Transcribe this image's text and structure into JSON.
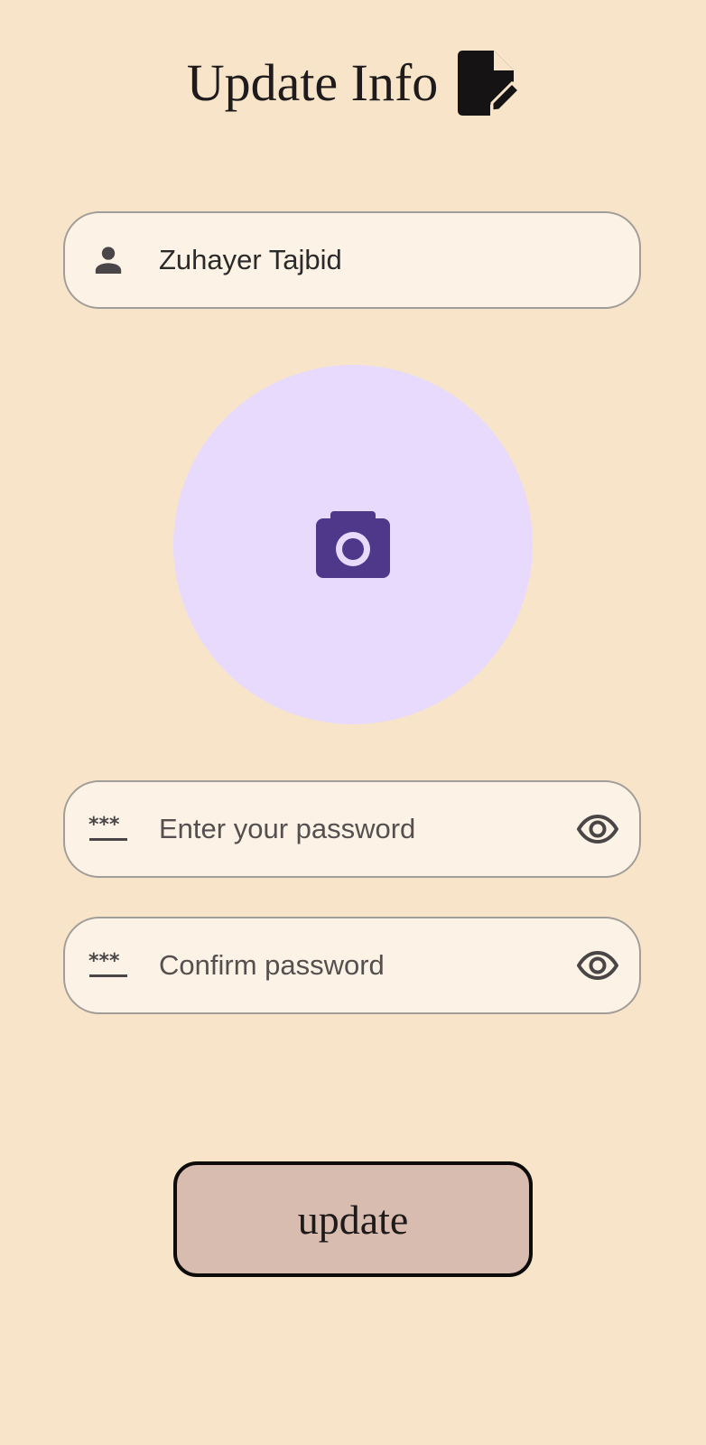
{
  "header": {
    "title": "Update Info",
    "icon": "edit-document-icon"
  },
  "form": {
    "name": {
      "icon": "person-icon",
      "value": "Zuhayer Tajbid"
    },
    "avatar": {
      "icon": "camera-icon",
      "background": "#e8dafd",
      "icon_color": "#4f378a"
    },
    "password": {
      "icon": "password-icon",
      "placeholder": "Enter your password",
      "value": "",
      "toggle_icon": "eye-icon"
    },
    "confirm_password": {
      "icon": "password-icon",
      "placeholder": "Confirm password",
      "value": "",
      "toggle_icon": "eye-icon"
    },
    "submit": {
      "label": "update"
    }
  },
  "colors": {
    "background": "#f8e5c9",
    "field_fill": "#fcf3e6",
    "field_border": "#a19d98",
    "button_fill": "#d8bcb0",
    "button_border": "#0e0b0b"
  }
}
